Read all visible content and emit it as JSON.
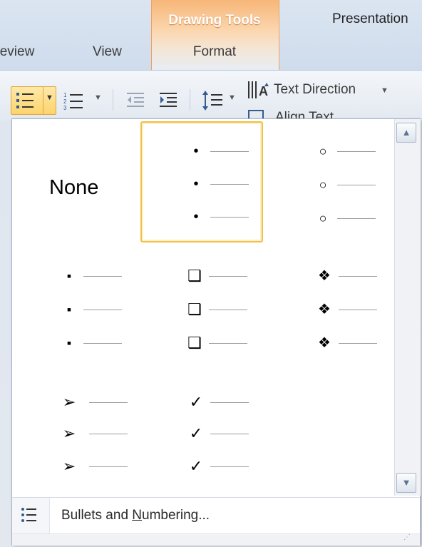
{
  "ribbon": {
    "tabs": [
      {
        "label": "Review"
      },
      {
        "label": "View"
      },
      {
        "label": "Format"
      }
    ],
    "contextual_group": "Drawing Tools",
    "window_title_partial": "Presentation"
  },
  "toolbar": {
    "text_direction_label": "Text Direction",
    "align_text_label_partial": "Align Text"
  },
  "gallery": {
    "none_label": "None",
    "styles": [
      {
        "name": "None",
        "glyph": ""
      },
      {
        "name": "Filled Round Bullets",
        "glyph": "•"
      },
      {
        "name": "Hollow Round Bullets",
        "glyph": "○"
      },
      {
        "name": "Filled Square Bullets",
        "glyph": "▪"
      },
      {
        "name": "Hollow Square Bullets",
        "glyph": "❑"
      },
      {
        "name": "Star Bullets",
        "glyph": "❖"
      },
      {
        "name": "Arrow Bullets",
        "glyph": "➢"
      },
      {
        "name": "Checkmark Bullets",
        "glyph": "✓"
      }
    ],
    "selected": "Filled Round Bullets"
  },
  "menu": {
    "bullets_numbering_prefix": "Bullets and ",
    "bullets_numbering_accel": "N",
    "bullets_numbering_suffix": "umbering..."
  },
  "colors": {
    "selection_border": "#f0c04a",
    "contextual_tab": "#f7b678",
    "icon_blue": "#355c8f"
  }
}
